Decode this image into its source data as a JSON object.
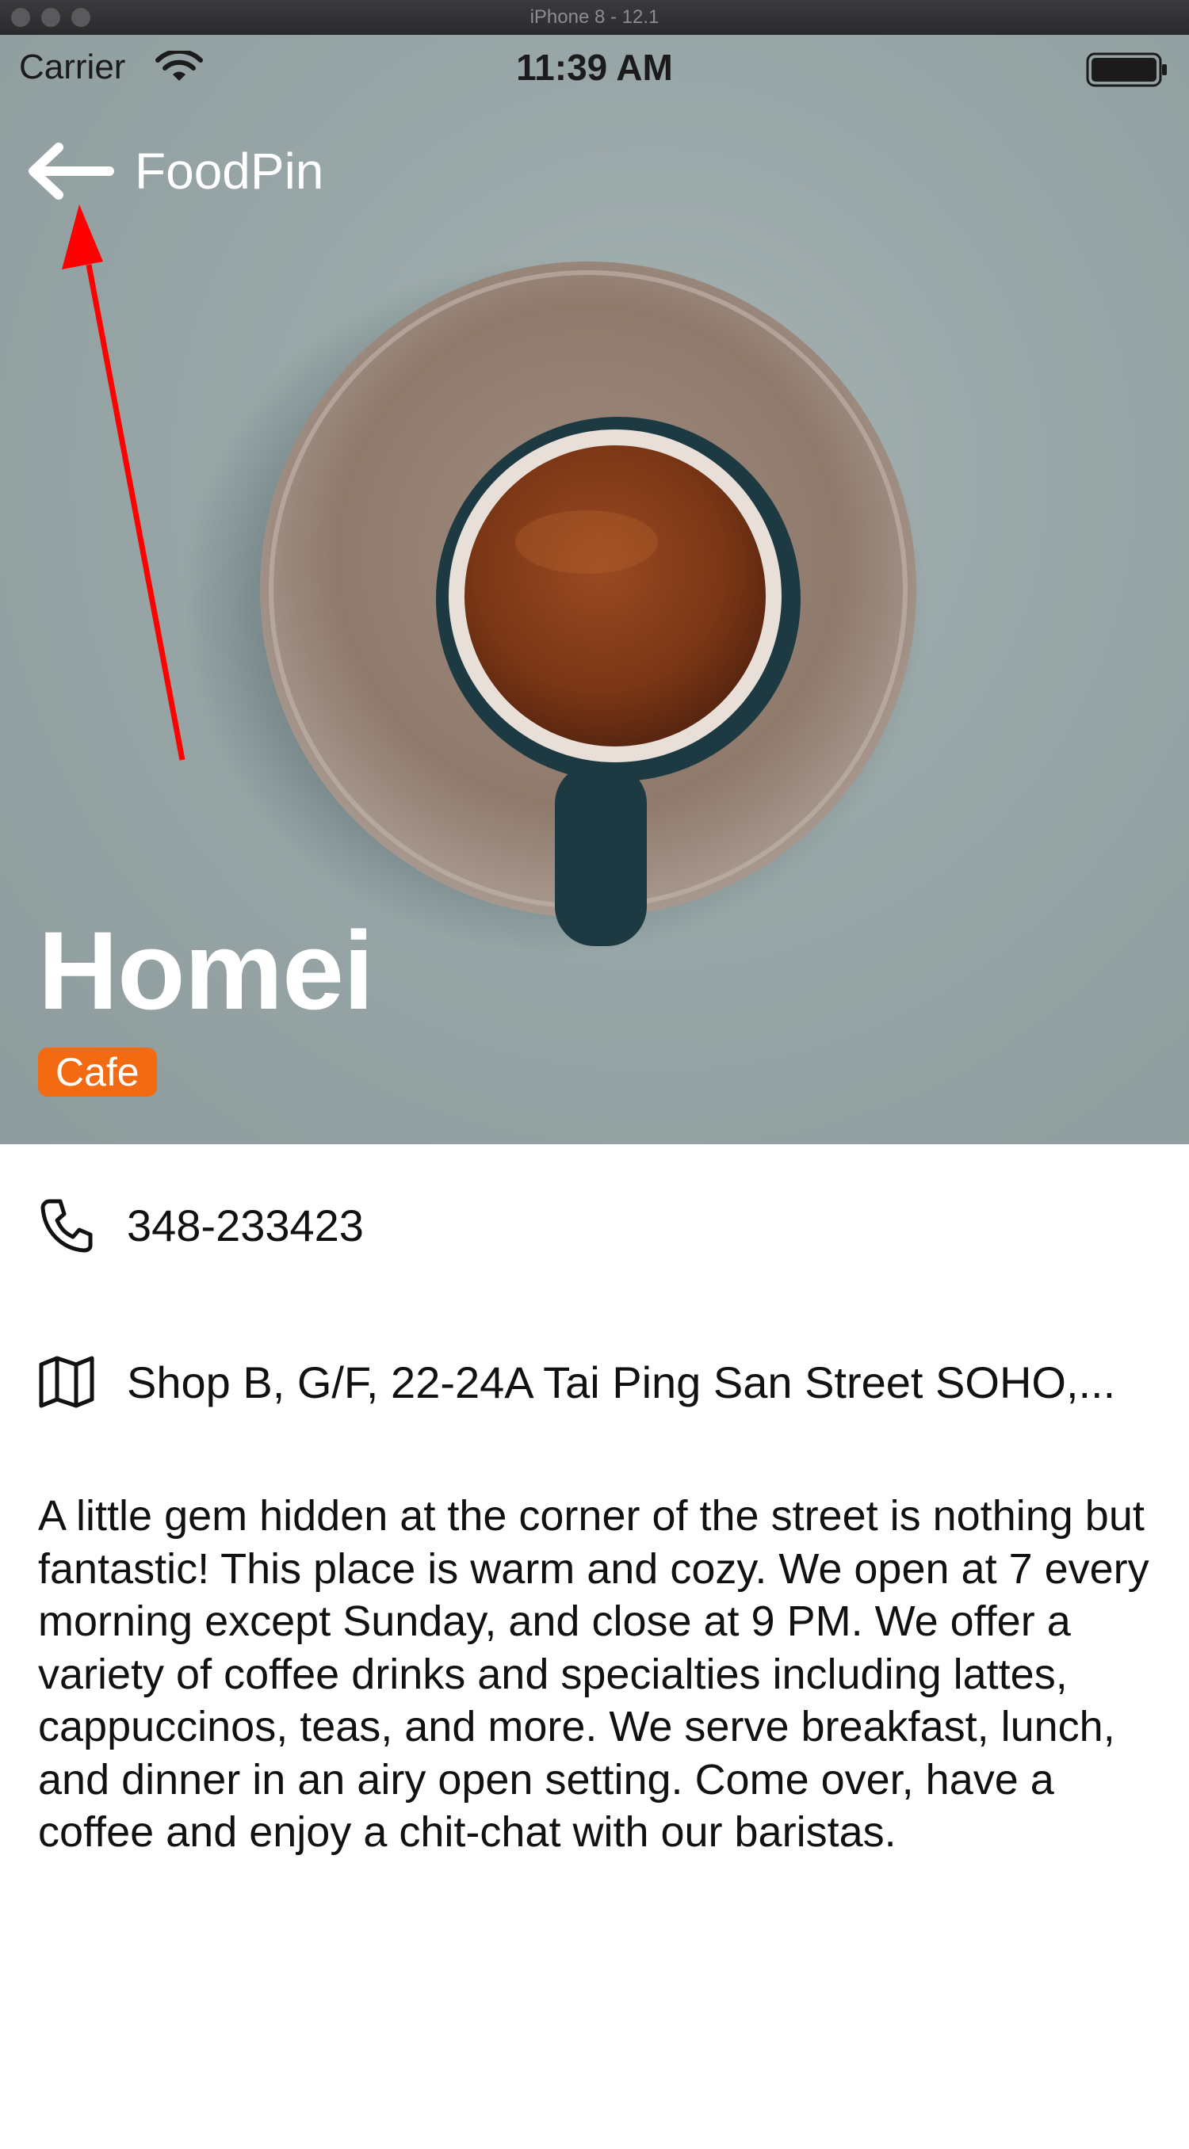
{
  "window": {
    "title": "iPhone 8 - 12.1"
  },
  "status_bar": {
    "carrier": "Carrier",
    "time": "11:39 AM"
  },
  "nav": {
    "back_label": "FoodPin"
  },
  "restaurant": {
    "name": "Homei",
    "type": "Cafe",
    "phone": "348-233423",
    "address": "Shop B, G/F, 22-24A Tai Ping San Street SOHO,...",
    "description": "A little gem hidden at the corner of the street is nothing but fantastic! This place is warm and cozy. We open at 7 every morning except Sunday, and close at 9 PM. We offer a variety of coffee drinks and specialties including lattes, cappuccinos, teas, and more. We serve breakfast, lunch, and dinner in an airy open setting. Come over, have a coffee and enjoy a chit-chat with our baristas."
  },
  "colors": {
    "badge": "#f26a12",
    "annotation_arrow": "#ff0000",
    "hero_bg": "#98a6a7"
  },
  "icons": [
    "back-arrow-icon",
    "wifi-icon",
    "battery-icon",
    "phone-icon",
    "map-icon"
  ]
}
